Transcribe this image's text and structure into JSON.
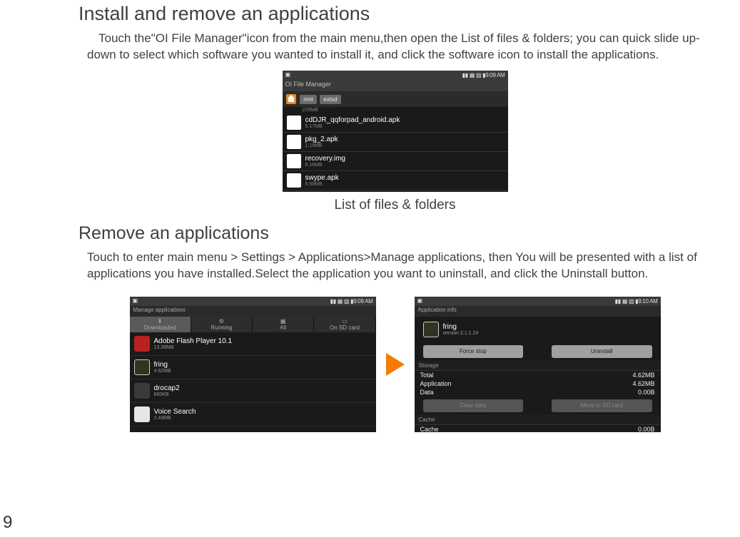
{
  "page_number": "9",
  "section1": {
    "heading": "Install and remove an applications",
    "paragraph": "Touch the\"OI File Manager\"icon from the main menu,then open the List of files & folders; you can  quick slide up-down to select which software you wanted to install it, and click the software icon to install the applications.",
    "caption": "List of files & folders"
  },
  "section2": {
    "heading": "Remove an applications",
    "paragraph": "Touch to enter main menu > Settings > Applications>Manage applications, then You will be presented with a list of applications you have installed.Select the application you want to uninstall, and click the Uninstall button."
  },
  "fm": {
    "title": "OI File Manager",
    "time": "9:09 AM",
    "tabs": [
      "mnt",
      "extsd"
    ],
    "free": "229MB",
    "files": [
      {
        "name": "cdDJR_qqforpad_android.apk",
        "size": "5.17MB"
      },
      {
        "name": "pkg_2.apk",
        "size": "1.19MB"
      },
      {
        "name": "recovery.img",
        "size": "6.16MB"
      },
      {
        "name": "swype.apk",
        "size": "5.59MB"
      }
    ]
  },
  "manage": {
    "title": "Manage applications",
    "time": "9:09 AM",
    "tabs": [
      "Downloaded",
      "Running",
      "All",
      "On SD card"
    ],
    "apps": [
      {
        "name": "Adobe Flash Player 10.1",
        "size": "13.39MB"
      },
      {
        "name": "fring",
        "size": "4.62MB"
      },
      {
        "name": "drocap2",
        "size": "660KB"
      },
      {
        "name": "Voice Search",
        "size": "2.43MB"
      }
    ]
  },
  "appinfo": {
    "title": "Application info",
    "time": "9:10 AM",
    "name": "fring",
    "ver": "version 2.1.1.24",
    "btn_force": "Force stop",
    "btn_uninst": "Uninstall",
    "storage_label": "Storage",
    "rows": [
      {
        "k": "Total",
        "v": "4.62MB"
      },
      {
        "k": "Application",
        "v": "4.62MB"
      },
      {
        "k": "Data",
        "v": "0.00B"
      }
    ],
    "btn_clear": "Clear data",
    "btn_sd": "Move to SD card",
    "cache_label": "Cache",
    "cache_row": {
      "k": "Cache",
      "v": "0.00B"
    }
  }
}
